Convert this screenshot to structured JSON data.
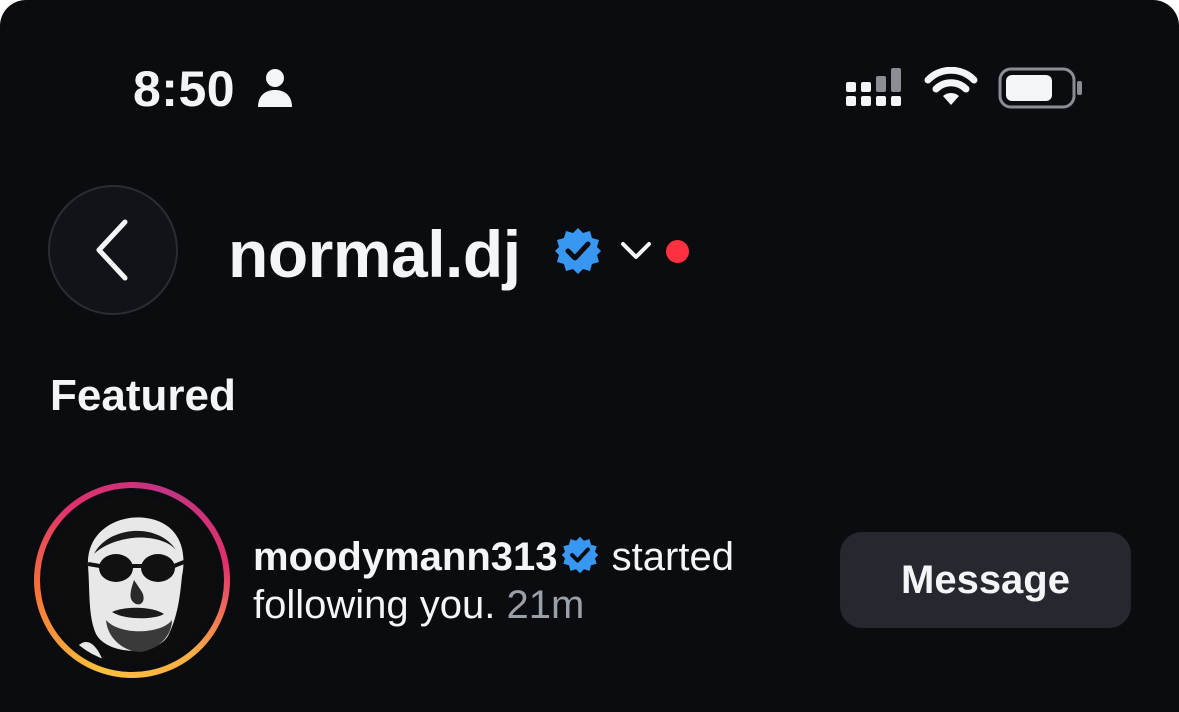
{
  "status_bar": {
    "time": "8:50",
    "icons": [
      "person-icon",
      "cellular-signal-icon",
      "wifi-icon",
      "battery-icon"
    ]
  },
  "header": {
    "title": "normal.dj",
    "verified": true,
    "icons": [
      "back-chevron-icon",
      "verified-badge-icon",
      "chevron-down-icon"
    ],
    "unread_dot_color": "#ff3040"
  },
  "featured": {
    "section_title": "Featured",
    "notifications": [
      {
        "username": "moodymann313",
        "verified": true,
        "action": "started following you.",
        "time_ago": "21m",
        "button_label": "Message"
      }
    ]
  },
  "colors": {
    "background": "#0b0c10",
    "verified_blue": "#3897f0",
    "button_bg": "#25282e",
    "muted_text": "#9aa0a8"
  }
}
